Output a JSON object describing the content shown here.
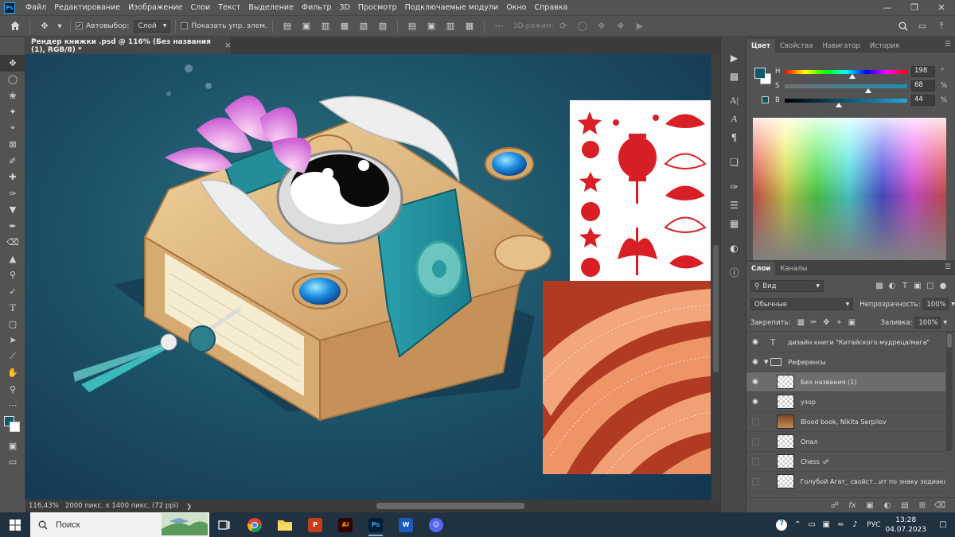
{
  "menu": [
    "Файл",
    "Редактирование",
    "Изображение",
    "Слои",
    "Текст",
    "Выделение",
    "Фильтр",
    "3D",
    "Просмотр",
    "Подключаемые модули",
    "Окно",
    "Справка"
  ],
  "app_logo": "Ps",
  "options": {
    "autoselect_label": "Автовыбор:",
    "autoselect_value": "Слой",
    "show_transform_label": "Показать упр. элем.",
    "mode_3d_label": "3D-режим:"
  },
  "document": {
    "tab_title": "Рендер книжки .psd @ 116% (Без названия (1), RGB/8) *",
    "zoom": "116,43%",
    "size_info": "2000 пикс. x 1400 пикс. (72 ppi)"
  },
  "color_panel": {
    "tabs": [
      "Цвет",
      "Свойства",
      "Навигатор",
      "История"
    ],
    "h_label": "H",
    "h_value": "198",
    "h_unit": "°",
    "s_label": "S",
    "s_value": "68",
    "s_unit": "%",
    "b_label": "B",
    "b_value": "44",
    "b_unit": "%",
    "h_fraction": 0.55,
    "s_fraction": 0.68,
    "b_fraction": 0.44
  },
  "layers_panel": {
    "tabs": [
      "Слои",
      "Каналы"
    ],
    "filter_label": "Вид",
    "blend_mode": "Обычные",
    "opacity_label": "Непрозрачность:",
    "opacity_value": "100%",
    "lock_label": "Закрепить:",
    "fill_label": "Заливка:",
    "fill_value": "100%",
    "layers": [
      {
        "name": "дизайн книги \"Китайского мудреца/мага\"",
        "visible": true,
        "kind": "text"
      },
      {
        "name": "Референсы",
        "visible": true,
        "kind": "group"
      },
      {
        "name": "Без названия (1)",
        "visible": true,
        "kind": "smart",
        "selected": true
      },
      {
        "name": "узор",
        "visible": true,
        "kind": "smart"
      },
      {
        "name": "Blood book, Nikita Serpilov",
        "visible": false,
        "kind": "smart"
      },
      {
        "name": "Опал",
        "visible": false,
        "kind": "smart"
      },
      {
        "name": "Chess",
        "visible": false,
        "kind": "smart"
      },
      {
        "name": "Голубой Агат_ свойст...ит по знаку зодиака",
        "visible": false,
        "kind": "smart"
      }
    ]
  },
  "taskbar": {
    "search_placeholder": "Поиск",
    "apps": [
      "Chrome",
      "Explorer",
      "PowerPoint",
      "Illustrator",
      "Photoshop",
      "Word",
      "Discord"
    ],
    "language": "РУС",
    "time": "13:28",
    "date": "04.07.2023"
  },
  "colors": {
    "foreground": "#0f5a6a",
    "background": "#ffffff",
    "accent": "#31a8ff"
  }
}
